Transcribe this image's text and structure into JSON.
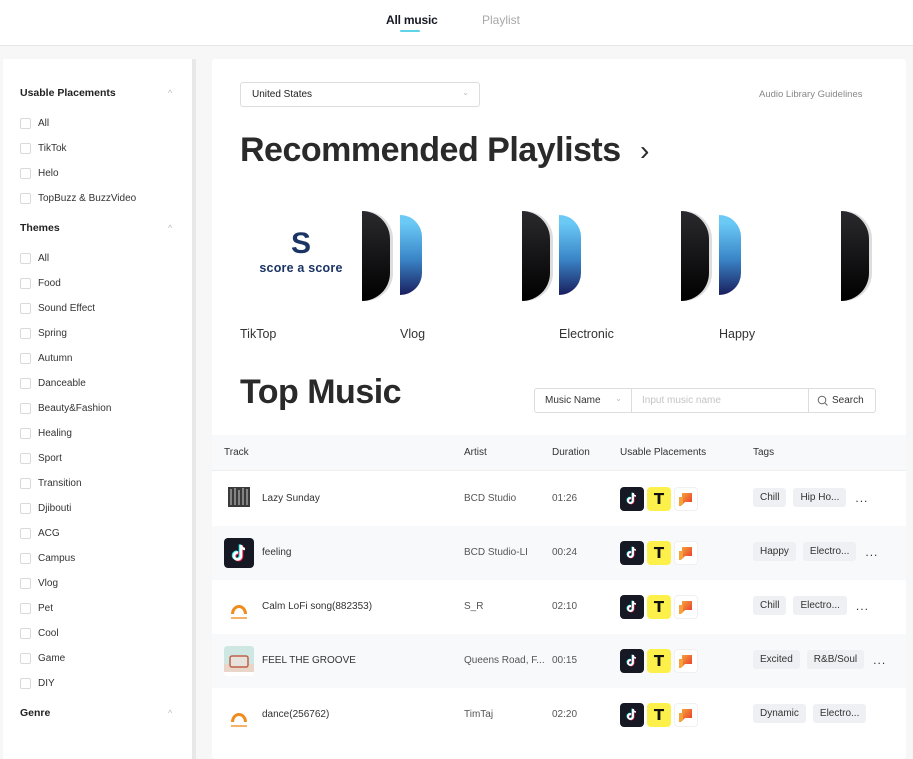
{
  "nav": {
    "tabs": [
      {
        "label": "All music",
        "active": true
      },
      {
        "label": "Playlist",
        "active": false
      }
    ],
    "accent_color": "#5ed4e6"
  },
  "sidebar": {
    "sections": [
      {
        "title": "Usable Placements",
        "items": [
          "All",
          "TikTok",
          "Helo",
          "TopBuzz & BuzzVideo"
        ]
      },
      {
        "title": "Themes",
        "items": [
          "All",
          "Food",
          "Sound Effect",
          "Spring",
          "Autumn",
          "Danceable",
          "Beauty&Fashion",
          "Healing",
          "Sport",
          "Transition",
          "Djibouti",
          "ACG",
          "Campus",
          "Vlog",
          "Pet",
          "Cool",
          "Game",
          "DIY"
        ]
      },
      {
        "title": "Genre",
        "items": []
      }
    ]
  },
  "main": {
    "country_select": "United States",
    "guidelines_link": "Audio Library Guidelines",
    "recommended_title": "Recommended Playlists",
    "playlists": [
      {
        "name": "TikTop",
        "cover_text": "score a score"
      },
      {
        "name": "Vlog"
      },
      {
        "name": "Electronic"
      },
      {
        "name": "Happy"
      }
    ],
    "top_music_title": "Top Music",
    "search": {
      "field_select": "Music Name",
      "placeholder": "Input music name",
      "button_label": "Search"
    },
    "table": {
      "columns": [
        "Track",
        "Artist",
        "Duration",
        "Usable Placements",
        "Tags"
      ],
      "rows": [
        {
          "track": "Lazy Sunday",
          "artist": "BCD Studio",
          "duration": "01:26",
          "thumb": "forest",
          "tags": [
            "Chill",
            "Hip Ho..."
          ]
        },
        {
          "track": "feeling",
          "artist": "BCD Studio-LI",
          "duration": "00:24",
          "thumb": "tiktok",
          "tags": [
            "Happy",
            "Electro..."
          ]
        },
        {
          "track": "Calm LoFi song(882353)",
          "artist": "S_R",
          "duration": "02:10",
          "thumb": "audiostock",
          "tags": [
            "Chill",
            "Electro..."
          ]
        },
        {
          "track": "FEEL THE GROOVE",
          "artist": "Queens Road, F...",
          "duration": "00:15",
          "thumb": "radio",
          "tags": [
            "Excited",
            "R&B/Soul"
          ]
        },
        {
          "track": "dance(256762)",
          "artist": "TimTaj",
          "duration": "02:20",
          "thumb": "audiostock",
          "tags": [
            "Dynamic",
            "Electro..."
          ]
        }
      ],
      "placement_icons": [
        "tiktok-icon",
        "topbuzz-icon",
        "helo-icon"
      ],
      "more_label": "..."
    }
  }
}
